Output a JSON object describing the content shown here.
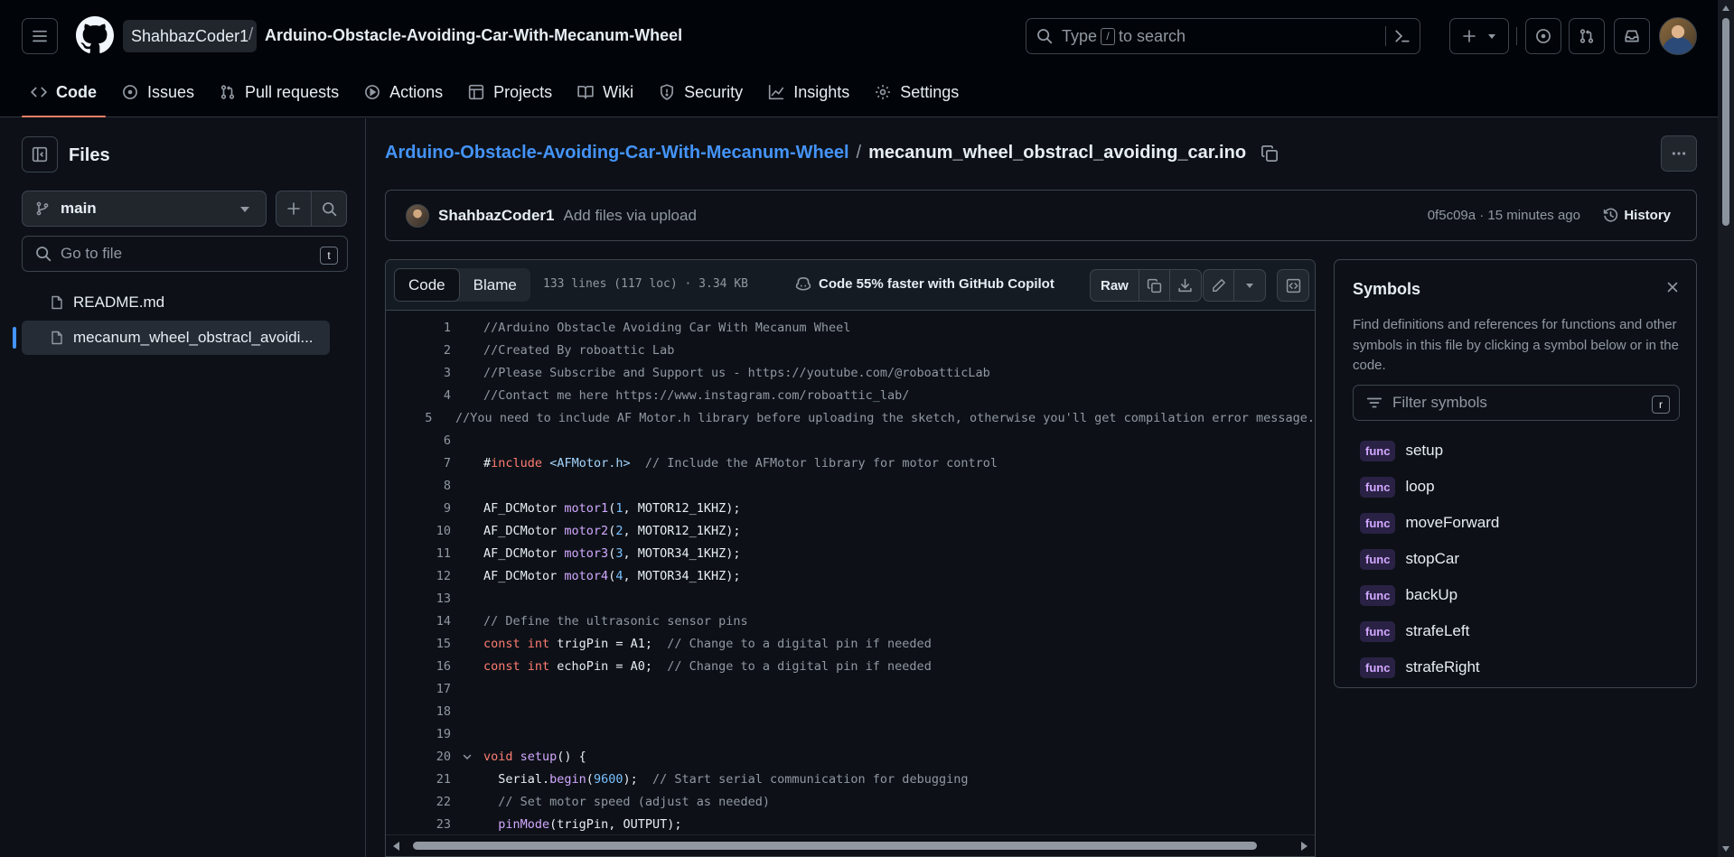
{
  "header": {
    "owner": "ShahbazCoder1",
    "slash": "/",
    "repo": "Arduino-Obstacle-Avoiding-Car-With-Mecanum-Wheel",
    "search": {
      "prefix": "Type",
      "key": "/",
      "suffix": "to search"
    }
  },
  "nav": {
    "tabs": [
      {
        "label": "Code",
        "icon": "code-icon",
        "active": true
      },
      {
        "label": "Issues",
        "icon": "issue-icon"
      },
      {
        "label": "Pull requests",
        "icon": "pull-request-icon"
      },
      {
        "label": "Actions",
        "icon": "play-icon"
      },
      {
        "label": "Projects",
        "icon": "table-icon"
      },
      {
        "label": "Wiki",
        "icon": "book-icon"
      },
      {
        "label": "Security",
        "icon": "shield-icon"
      },
      {
        "label": "Insights",
        "icon": "graph-icon"
      },
      {
        "label": "Settings",
        "icon": "gear-icon"
      }
    ]
  },
  "sidebar": {
    "title": "Files",
    "branch": "main",
    "goto_placeholder": "Go to file",
    "goto_key": "t",
    "files": [
      {
        "name": "README.md"
      },
      {
        "name": "mecanum_wheel_obstracl_avoidi..."
      }
    ]
  },
  "breadcrumb": {
    "repo": "Arduino-Obstacle-Avoiding-Car-With-Mecanum-Wheel",
    "sep": "/",
    "file": "mecanum_wheel_obstracl_avoiding_car.ino"
  },
  "commit": {
    "author": "ShahbazCoder1",
    "message": "Add files via upload",
    "meta": "0f5c09a · 15 minutes ago",
    "history": "History"
  },
  "code_toolbar": {
    "code_tab": "Code",
    "blame_tab": "Blame",
    "info": "133 lines (117 loc) · 3.34 KB",
    "copilot": "Code 55% faster with GitHub Copilot",
    "raw": "Raw"
  },
  "code_lines": [
    {
      "n": "1",
      "t": [
        [
          "c-comment",
          "//Arduino Obstacle Avoiding Car With Mecanum Wheel"
        ]
      ]
    },
    {
      "n": "2",
      "t": [
        [
          "c-comment",
          "//Created By roboattic Lab"
        ]
      ]
    },
    {
      "n": "3",
      "t": [
        [
          "c-comment",
          "//Please Subscribe and Support us - https://youtube.com/@roboatticLab"
        ]
      ]
    },
    {
      "n": "4",
      "t": [
        [
          "c-comment",
          "//Contact me here https://www.instagram.com/roboattic_lab/"
        ]
      ]
    },
    {
      "n": "5",
      "t": [
        [
          "c-comment",
          "//You need to include AF Motor.h library before uploading the sketch, otherwise you'll get compilation error message."
        ]
      ]
    },
    {
      "n": "6",
      "t": []
    },
    {
      "n": "7",
      "t": [
        [
          "c-plain",
          "#"
        ],
        [
          "c-kw",
          "include"
        ],
        [
          "c-plain",
          " "
        ],
        [
          "c-str",
          "<AFMotor.h>"
        ],
        [
          "c-plain",
          "  "
        ],
        [
          "c-comment",
          "// Include the AFMotor library for motor control"
        ]
      ]
    },
    {
      "n": "8",
      "t": []
    },
    {
      "n": "9",
      "t": [
        [
          "c-plain",
          "AF_DCMotor "
        ],
        [
          "c-fn",
          "motor1"
        ],
        [
          "c-plain",
          "("
        ],
        [
          "c-num",
          "1"
        ],
        [
          "c-plain",
          ", MOTOR12_1KHZ);"
        ]
      ]
    },
    {
      "n": "10",
      "t": [
        [
          "c-plain",
          "AF_DCMotor "
        ],
        [
          "c-fn",
          "motor2"
        ],
        [
          "c-plain",
          "("
        ],
        [
          "c-num",
          "2"
        ],
        [
          "c-plain",
          ", MOTOR12_1KHZ);"
        ]
      ]
    },
    {
      "n": "11",
      "t": [
        [
          "c-plain",
          "AF_DCMotor "
        ],
        [
          "c-fn",
          "motor3"
        ],
        [
          "c-plain",
          "("
        ],
        [
          "c-num",
          "3"
        ],
        [
          "c-plain",
          ", MOTOR34_1KHZ);"
        ]
      ]
    },
    {
      "n": "12",
      "t": [
        [
          "c-plain",
          "AF_DCMotor "
        ],
        [
          "c-fn",
          "motor4"
        ],
        [
          "c-plain",
          "("
        ],
        [
          "c-num",
          "4"
        ],
        [
          "c-plain",
          ", MOTOR34_1KHZ);"
        ]
      ]
    },
    {
      "n": "13",
      "t": []
    },
    {
      "n": "14",
      "t": [
        [
          "c-comment",
          "// Define the ultrasonic sensor pins"
        ]
      ]
    },
    {
      "n": "15",
      "t": [
        [
          "c-kw",
          "const"
        ],
        [
          "c-plain",
          " "
        ],
        [
          "c-kw",
          "int"
        ],
        [
          "c-plain",
          " trigPin = A1;  "
        ],
        [
          "c-comment",
          "// Change to a digital pin if needed"
        ]
      ]
    },
    {
      "n": "16",
      "t": [
        [
          "c-kw",
          "const"
        ],
        [
          "c-plain",
          " "
        ],
        [
          "c-kw",
          "int"
        ],
        [
          "c-plain",
          " echoPin = A0;  "
        ],
        [
          "c-comment",
          "// Change to a digital pin if needed"
        ]
      ]
    },
    {
      "n": "17",
      "t": []
    },
    {
      "n": "18",
      "t": []
    },
    {
      "n": "19",
      "t": []
    },
    {
      "n": "20",
      "fold": true,
      "t": [
        [
          "c-kw",
          "void"
        ],
        [
          "c-plain",
          " "
        ],
        [
          "c-fn",
          "setup"
        ],
        [
          "c-plain",
          "() {"
        ]
      ]
    },
    {
      "n": "21",
      "t": [
        [
          "c-plain",
          "  Serial."
        ],
        [
          "c-fn",
          "begin"
        ],
        [
          "c-plain",
          "("
        ],
        [
          "c-num",
          "9600"
        ],
        [
          "c-plain",
          ");  "
        ],
        [
          "c-comment",
          "// Start serial communication for debugging"
        ]
      ]
    },
    {
      "n": "22",
      "t": [
        [
          "c-plain",
          "  "
        ],
        [
          "c-comment",
          "// Set motor speed (adjust as needed)"
        ]
      ]
    },
    {
      "n": "23",
      "t": [
        [
          "c-plain",
          "  "
        ],
        [
          "c-fn",
          "pinMode"
        ],
        [
          "c-plain",
          "(trigPin, OUTPUT);"
        ]
      ]
    }
  ],
  "symbols": {
    "title": "Symbols",
    "description": "Find definitions and references for functions and other symbols in this file by clicking a symbol below or in the code.",
    "filter_placeholder": "Filter symbols",
    "filter_key": "r",
    "items": [
      {
        "kind": "func",
        "name": "setup"
      },
      {
        "kind": "func",
        "name": "loop"
      },
      {
        "kind": "func",
        "name": "moveForward"
      },
      {
        "kind": "func",
        "name": "stopCar"
      },
      {
        "kind": "func",
        "name": "backUp"
      },
      {
        "kind": "func",
        "name": "strafeLeft"
      },
      {
        "kind": "func",
        "name": "strafeRight"
      }
    ]
  },
  "colors": {
    "background": "#0d1117",
    "header_bg": "#010409",
    "link": "#4493f8",
    "active_tab_underline": "#f78166"
  }
}
